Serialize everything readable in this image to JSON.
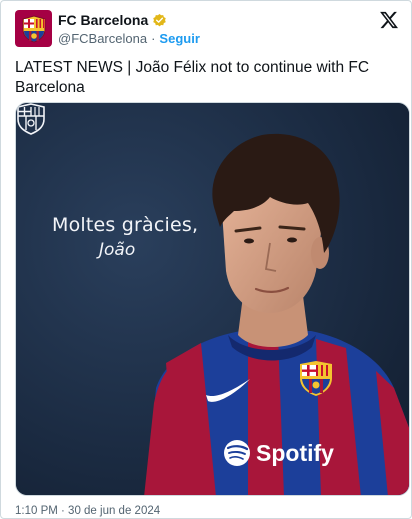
{
  "account": {
    "name": "FC Barcelona",
    "handle": "@FCBarcelona",
    "separator": "·",
    "follow_label": "Seguir",
    "avatar_icon": "fc-barcelona-crest",
    "verified_icon": "verified-gold-badge",
    "verified_color": "#e2b719"
  },
  "platform_icon": "x-logo",
  "tweet": {
    "text": "LATEST NEWS | João Félix not to continue with FC Barcelona",
    "timestamp": "1:10 PM · 30 de jun de 2024"
  },
  "media": {
    "overlay_line1": "Moltes gràcies,",
    "overlay_line2": "João",
    "sponsor_text": "Spotify",
    "colors": {
      "background": "#1b2b42",
      "blaugrana_blue": "#1c3f9a",
      "blaugrana_red": "#a8163a",
      "follow_blue": "#1d9bf0"
    }
  }
}
